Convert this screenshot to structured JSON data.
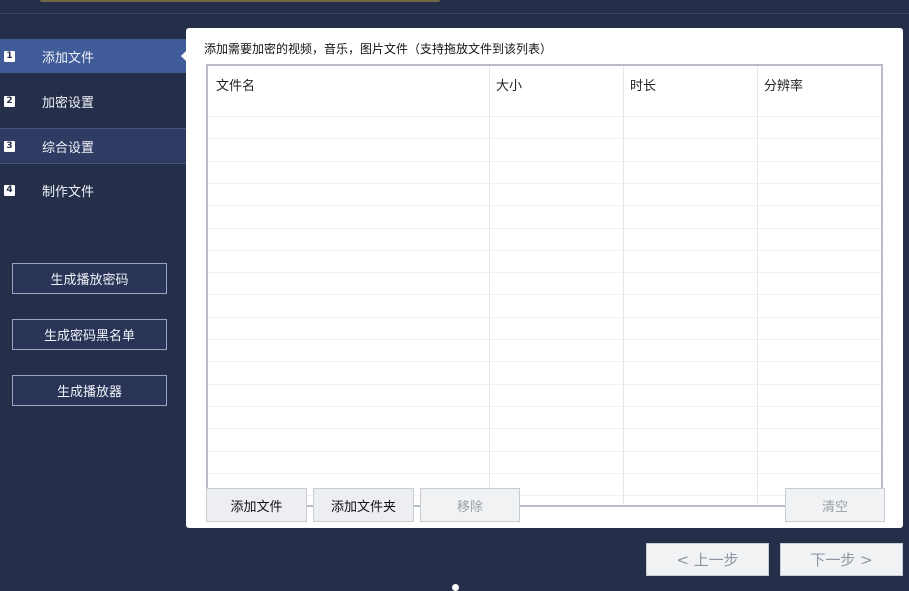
{
  "sidebar": {
    "steps": [
      {
        "num": "1",
        "label": "添加文件",
        "state": "active"
      },
      {
        "num": "2",
        "label": "加密设置",
        "state": "normal"
      },
      {
        "num": "3",
        "label": "综合设置",
        "state": "hover"
      },
      {
        "num": "4",
        "label": "制作文件",
        "state": "normal"
      }
    ],
    "buttons": [
      {
        "label": "生成播放密码"
      },
      {
        "label": "生成密码黑名单"
      },
      {
        "label": "生成播放器"
      }
    ]
  },
  "main": {
    "title": "添加需要加密的视频，音乐，图片文件（支持拖放文件到该列表）",
    "table": {
      "columns": [
        "文件名",
        "大小",
        "时长",
        "分辨率"
      ],
      "rows": []
    },
    "buttons": {
      "add_file": "添加文件",
      "add_folder": "添加文件夹",
      "remove": "移除",
      "clear": "清空"
    }
  },
  "footer": {
    "prev": "< 上一步",
    "next": "下一步 >"
  },
  "colors": {
    "background": "#262f4a",
    "active_step": "#3f5b98",
    "panel": "#ffffff"
  }
}
